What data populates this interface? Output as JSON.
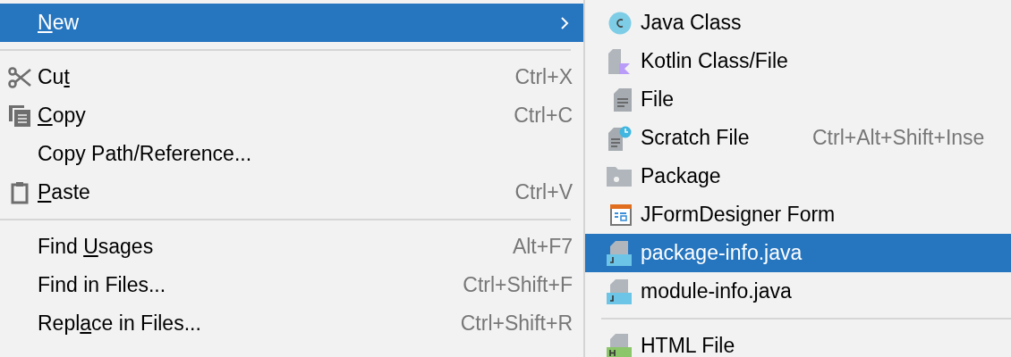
{
  "context_menu": {
    "items": [
      {
        "kind": "item",
        "mnemonic": "N",
        "label_after": "ew",
        "submenu": true,
        "selected": true
      },
      {
        "kind": "separator"
      },
      {
        "kind": "item",
        "label_before": "Cu",
        "mnemonic": "t",
        "shortcut": "Ctrl+X",
        "selected": false
      },
      {
        "kind": "item",
        "mnemonic": "C",
        "label_after": "opy",
        "shortcut": "Ctrl+C",
        "selected": false
      },
      {
        "kind": "item",
        "label_before": "Copy Path/Reference...",
        "selected": false
      },
      {
        "kind": "item",
        "mnemonic": "P",
        "label_after": "aste",
        "shortcut": "Ctrl+V",
        "selected": false
      },
      {
        "kind": "separator"
      },
      {
        "kind": "item",
        "label_before": "Find ",
        "mnemonic": "U",
        "label_after": "sages",
        "shortcut": "Alt+F7",
        "selected": false
      },
      {
        "kind": "item",
        "label_before": "Find in Files...",
        "shortcut": "Ctrl+Shift+F",
        "selected": false
      },
      {
        "kind": "item",
        "label_before": "Repl",
        "mnemonic": "a",
        "label_after": "ce in Files...",
        "shortcut": "Ctrl+Shift+R",
        "selected": false
      }
    ]
  },
  "submenu": {
    "items": [
      {
        "kind": "item",
        "label": "Java Class",
        "selected": false
      },
      {
        "kind": "item",
        "label": "Kotlin Class/File",
        "selected": false
      },
      {
        "kind": "item",
        "label": "File",
        "selected": false
      },
      {
        "kind": "item",
        "label": "Scratch File",
        "shortcut": "Ctrl+Alt+Shift+Inse",
        "selected": false
      },
      {
        "kind": "item",
        "label": "Package",
        "selected": false
      },
      {
        "kind": "item",
        "label": "JFormDesigner Form",
        "selected": false
      },
      {
        "kind": "item",
        "label": "package-info.java",
        "selected": true
      },
      {
        "kind": "item",
        "label": "module-info.java",
        "selected": false
      },
      {
        "kind": "separator"
      },
      {
        "kind": "item",
        "label": "HTML File",
        "selected": false
      }
    ]
  }
}
